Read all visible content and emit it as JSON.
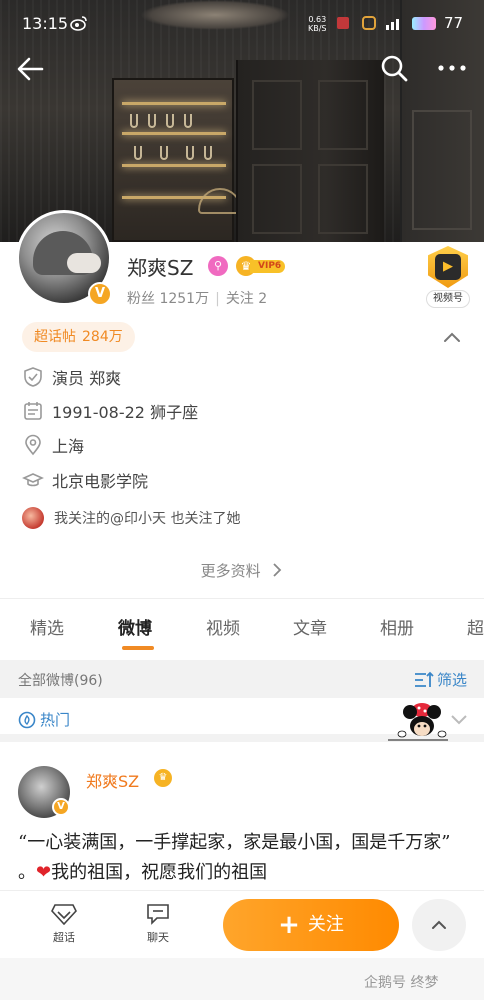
{
  "status_bar": {
    "time": "13:15",
    "speed_value": "0.63",
    "speed_unit": "KB/S",
    "battery": "77"
  },
  "profile": {
    "name": "郑爽SZ",
    "vip_label": "VIP6",
    "avatar_badge": "V",
    "fans_label": "粉丝",
    "fans_count": "1251万",
    "following_label": "关注",
    "following_count": "2",
    "video_badge_label": "视频号"
  },
  "supertopic": {
    "label": "超话帖",
    "count": "284万"
  },
  "info": {
    "occupation": "演员  郑爽",
    "birthday": "1991-08-22  狮子座",
    "location": "上海",
    "school": "北京电影学院",
    "mutual": "我关注的@印小天  也关注了她",
    "more_info": "更多资料"
  },
  "tabs": [
    "精选",
    "微博",
    "视频",
    "文章",
    "相册",
    "超"
  ],
  "active_tab": "微博",
  "feed": {
    "all_label": "全部微博(96)",
    "filter_label": "筛选",
    "hot_label": "热门"
  },
  "post": {
    "author": "郑爽SZ",
    "text_before_heart": "“一心装满国，一手撑起家，家是最小国，国是千万家”  。",
    "heart": "❤",
    "text_after_heart": "我的祖国，祝愿我们的祖国"
  },
  "bottom_bar": {
    "supertopic": "超话",
    "chat": "聊天",
    "follow": "关注"
  },
  "watermark": "企鹅号 终梦",
  "colors": {
    "accent": "#f08a24",
    "link_blue": "#3a86c8",
    "follow_button": "#ff9a15"
  }
}
